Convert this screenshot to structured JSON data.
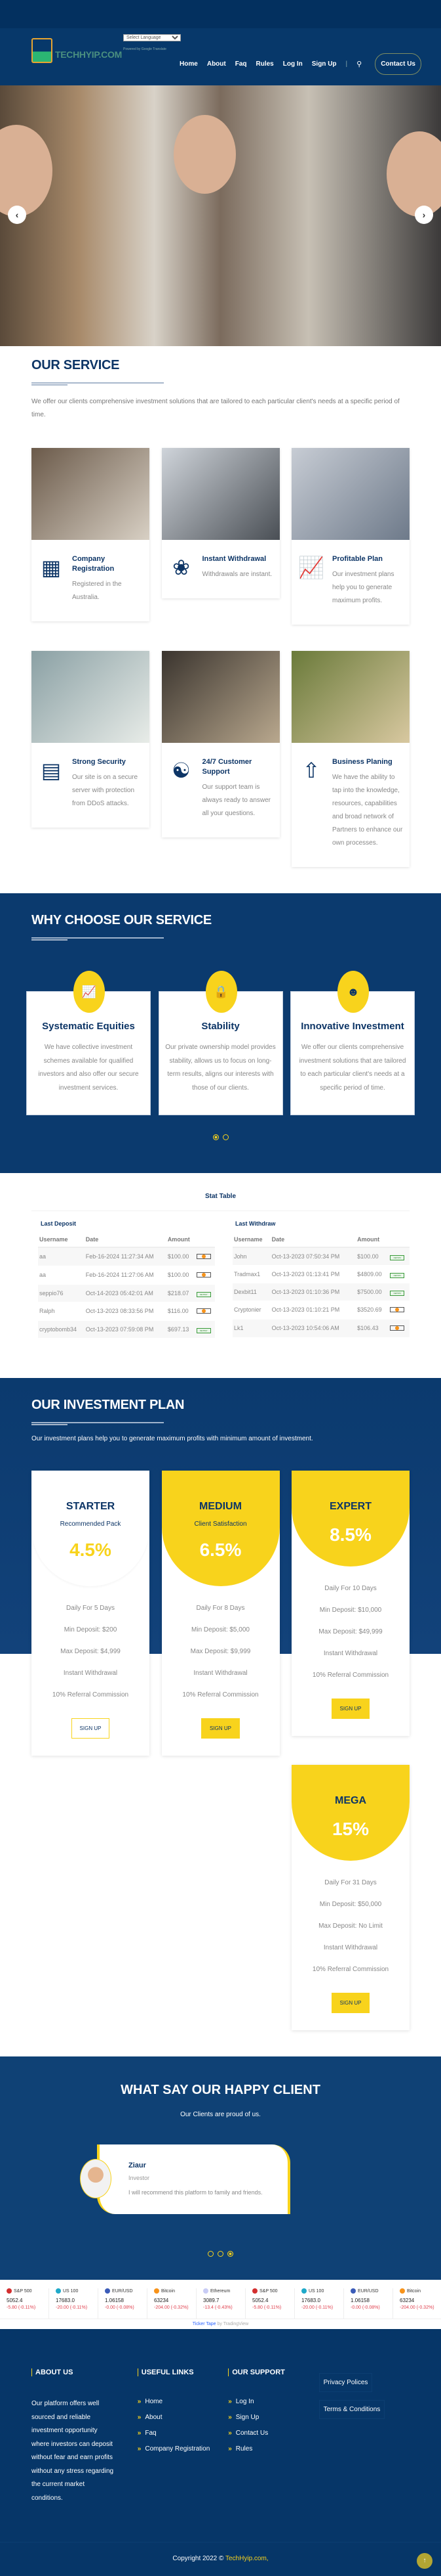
{
  "header": {
    "logo_text": "TECHHYIP.COM",
    "language_select": "Select Language",
    "powered_by": "Powered by Google Translate",
    "nav": [
      "Home",
      "About",
      "Faq",
      "Rules",
      "Log In",
      "Sign Up"
    ],
    "contact_label": "Contact Us"
  },
  "service": {
    "title": "OUR SERVICE",
    "lead": "We offer our clients comprehensive investment solutions that are tailored to each particular client's needs at a specific period of time.",
    "cards": [
      {
        "title": "Company Registration",
        "desc": "Registered in the Australia.",
        "icon": "strategy-board-icon"
      },
      {
        "title": "Instant Withdrawal",
        "desc": "Withdrawals are instant.",
        "icon": "growth-plant-hand-icon"
      },
      {
        "title": "Profitable Plan",
        "desc": "Our investment plans help you to generate maximum profits.",
        "icon": "chart-dollar-magnifier-icon"
      },
      {
        "title": "Strong Security",
        "desc": "Our site is on a secure server with protection from DDoS attacks.",
        "icon": "money-stack-icon"
      },
      {
        "title": "24/7 Customer Support",
        "desc": "Our support team is always ready to answer all your questions.",
        "icon": "team-network-icon"
      },
      {
        "title": "Business Planing",
        "desc": "We have the ability to tap into the knowledge, resources, capabilities and broad network of Partners to enhance our own processes.",
        "icon": "rocket-launch-icon"
      }
    ]
  },
  "why": {
    "title": "WHY CHOOSE OUR SERVICE",
    "cards": [
      {
        "title": "Systematic Equities",
        "desc": "We have collective investment schemes available for qualified investors and also offer our secure investment services.",
        "icon": "growth-chart-icon"
      },
      {
        "title": "Stability",
        "desc": "Our private ownership model provides stability, allows us to focus on long-term results, aligns our interests with those of our clients.",
        "icon": "padlock-icon"
      },
      {
        "title": "Innovative Investment",
        "desc": "We offer our clients comprehensive investment solutions that are tailored to each particular client's needs at a specific period of time.",
        "icon": "group-icon"
      }
    ],
    "active_slide": 1,
    "slides": 2
  },
  "stats": {
    "title": "Stat Table",
    "deposit": {
      "title": "Last Deposit",
      "headers": [
        "Username",
        "Date",
        "Amount"
      ],
      "rows": [
        [
          "aa",
          "Feb-16-2024 11:27:34 AM",
          "$100.00",
          "bitcoin"
        ],
        [
          "aa",
          "Feb-16-2024 11:27:06 AM",
          "$100.00",
          "bitcoin"
        ],
        [
          "seppio76",
          "Oct-14-2023 05:42:01 AM",
          "$218.07",
          "netpay"
        ],
        [
          "Ralph",
          "Oct-13-2023 08:33:56 PM",
          "$116.00",
          "bitcoin"
        ],
        [
          "cryptobomb34",
          "Oct-13-2023 07:59:08 PM",
          "$697.13",
          "netpay"
        ]
      ]
    },
    "withdraw": {
      "title": "Last Withdraw",
      "headers": [
        "Username",
        "Date",
        "Amount"
      ],
      "rows": [
        [
          "John",
          "Oct-13-2023 07:50:34 PM",
          "$100.00",
          "netpay"
        ],
        [
          "Tradmax1",
          "Oct-13-2023 01:13:41 PM",
          "$4809.00",
          "netpay"
        ],
        [
          "Dexbit11",
          "Oct-13-2023 01:10:36 PM",
          "$7500.00",
          "netpay"
        ],
        [
          "Cryptonier",
          "Oct-13-2023 01:10:21 PM",
          "$3520.69",
          "bitcoin"
        ],
        [
          "Lk1",
          "Oct-13-2023 10:54:06 AM",
          "$106.43",
          "bitcoin"
        ]
      ]
    },
    "netpay_label": "NETPAY"
  },
  "plans": {
    "title": "OUR INVESTMENT PLAN",
    "lead": "Our investment plans help you to generate maximum profits with minimum amount of investment.",
    "button": "SIGN UP",
    "items": [
      {
        "name": "STARTER",
        "sub": "Recommended Pack",
        "rate": "4.5%",
        "features": [
          "Daily For 5 Days",
          "Min Deposit: $200",
          "Max Deposit: $4,999",
          "Instant Withdrawal",
          "10% Referral Commission"
        ]
      },
      {
        "name": "MEDIUM",
        "sub": "Client Satisfaction",
        "rate": "6.5%",
        "features": [
          "Daily For 8 Days",
          "Min Deposit: $5,000",
          "Max Deposit: $9,999",
          "Instant Withdrawal",
          "10% Referral Commission"
        ]
      },
      {
        "name": "EXPERT",
        "sub": "",
        "rate": "8.5%",
        "features": [
          "Daily For 10 Days",
          "Min Deposit: $10,000",
          "Max Deposit: $49,999",
          "Instant Withdrawal",
          "10% Referral Commission"
        ]
      },
      {
        "name": "MEGA",
        "sub": "",
        "rate": "15%",
        "features": [
          "Daily For 31 Days",
          "Min Deposit: $50,000",
          "Max Deposit: No Limit",
          "Instant Withdrawal",
          "10% Referral Commission"
        ]
      }
    ]
  },
  "testimonial": {
    "title": "WHAT SAY OUR HAPPY CLIENT",
    "sub": "Our Clients are proud of us.",
    "name": "Ziaur",
    "role": "Investor",
    "quote": "I will recommend this platform to family and friends.",
    "active_slide": 3,
    "slides": 3
  },
  "ticker": {
    "items": [
      {
        "name": "S&P 500",
        "value": "5052.4",
        "change": "-5.80 (-0.11%)",
        "color": "#d32f2f"
      },
      {
        "name": "US 100",
        "value": "17683.0",
        "change": "-20.00 (-0.11%)",
        "color": "#1fa9c9"
      },
      {
        "name": "EUR/USD",
        "value": "1.06158",
        "change": "-0.00 (-0.08%)",
        "color": "#3b5cb8"
      },
      {
        "name": "Bitcoin",
        "value": "63234",
        "change": "-204.00 (-0.32%)",
        "color": "#f7931a"
      },
      {
        "name": "Ethereum",
        "value": "3089.7",
        "change": "-13.4 (-0.43%)",
        "color": "#c8ccf5"
      }
    ],
    "credit_link": "Ticker Tape",
    "credit_rest": " by TradingView"
  },
  "footer": {
    "about_title": "ABOUT US",
    "about_text": "Our platform offers well sourced and reliable investment opportunity where investors can deposit without fear and earn profits without any stress regarding the current market conditions.",
    "useful_title": "USEFUL LINKS",
    "useful": [
      "Home",
      "About",
      "Faq",
      "Company Registration"
    ],
    "support_title": "OUR SUPPORT",
    "support": [
      "Log In",
      "Sign Up",
      "Contact Us",
      "Rules"
    ],
    "extra": [
      "Privacy Polices",
      "Terms & Conditions"
    ],
    "copyright": "Copyright 2022 © ",
    "brand": "TechHyip.com,"
  },
  "colors": {
    "navy": "#0d3566",
    "accent_yellow": "#f8d31c",
    "negative": "#e0424f"
  }
}
